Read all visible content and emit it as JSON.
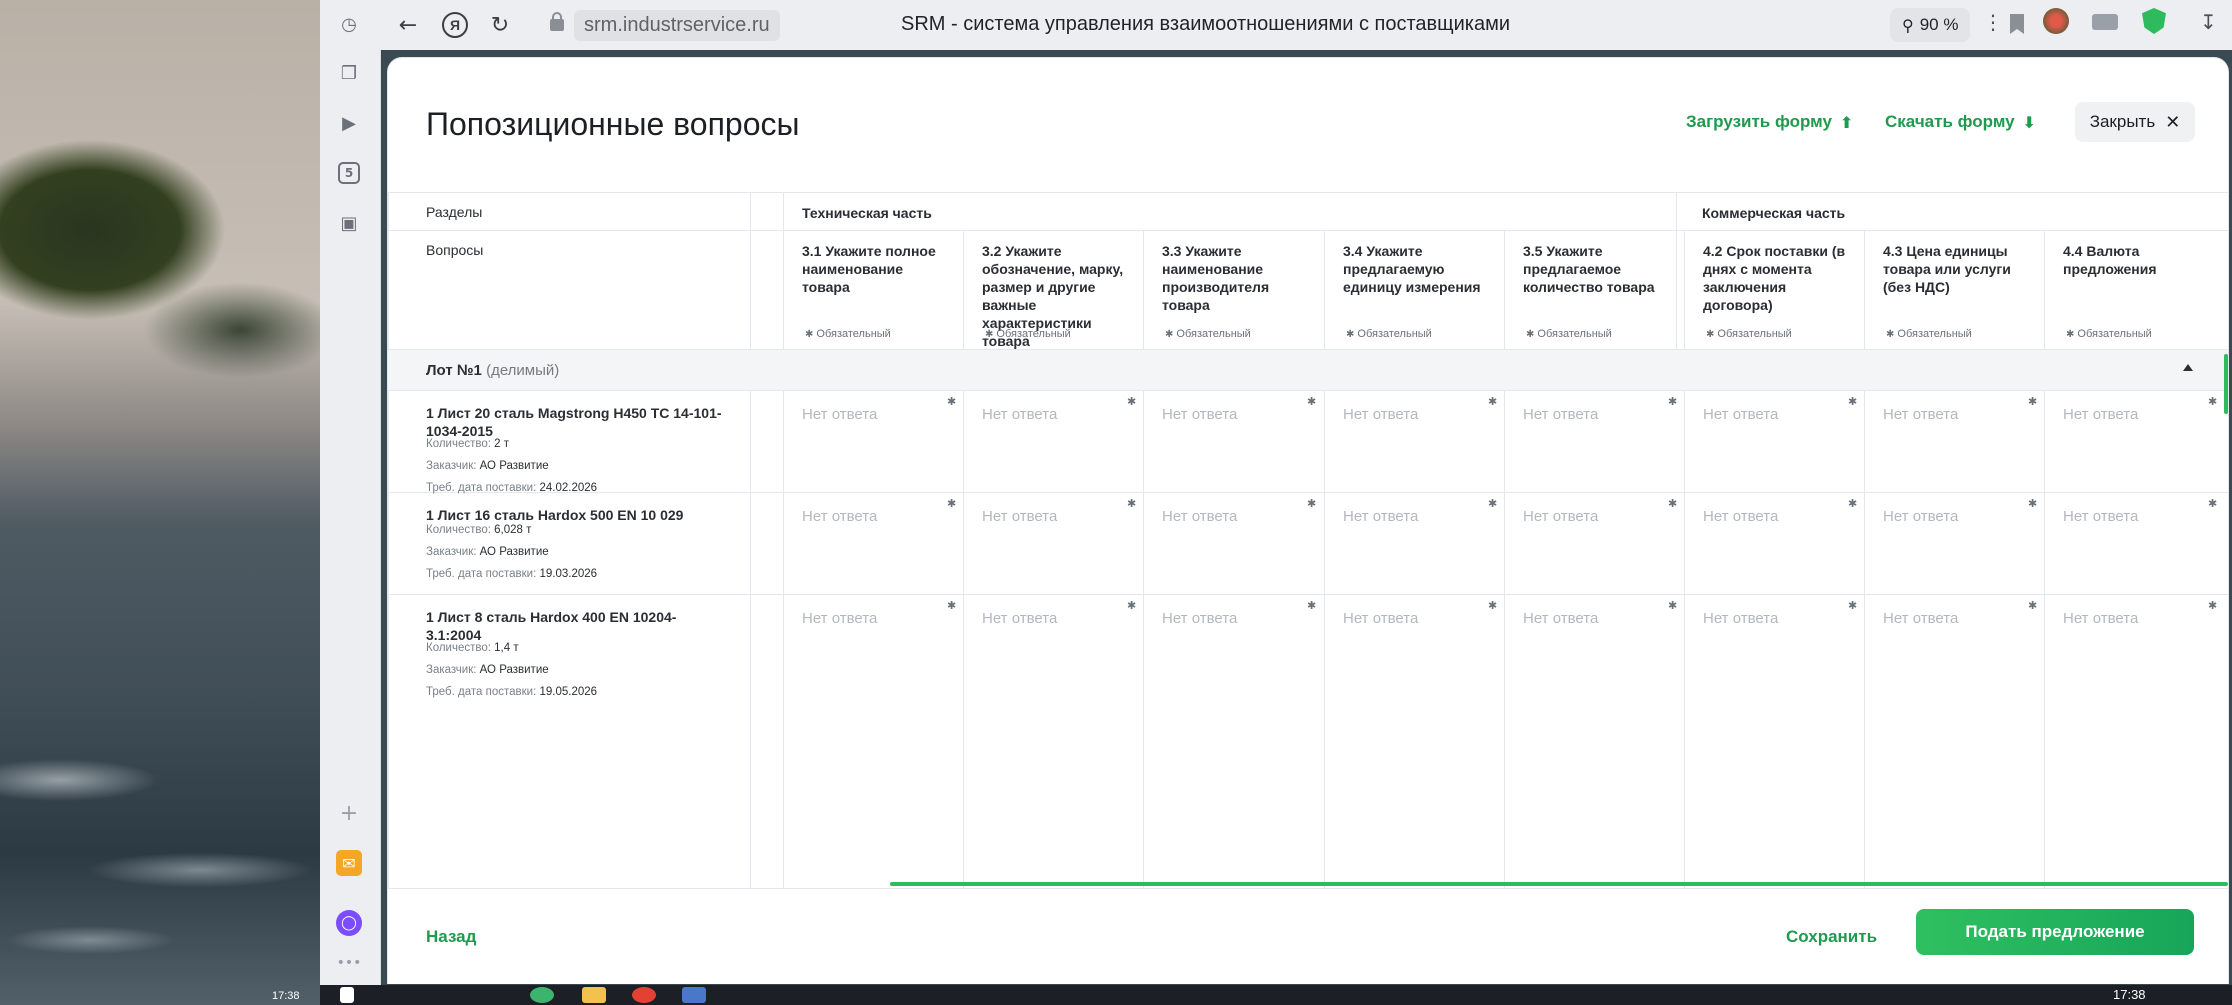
{
  "browser": {
    "url": "srm.industrservice.ru",
    "page_title": "SRM - система управления взаимоотношениями с поставщиками",
    "zoom": "90 %",
    "sidebar_badge": "5"
  },
  "page": {
    "title": "Попозиционные вопросы",
    "actions": {
      "upload_label": "Загрузить форму",
      "download_label": "Скачать форму",
      "close_label": "Закрыть"
    }
  },
  "table": {
    "sections_label": "Разделы",
    "questions_label": "Вопросы",
    "sections": [
      {
        "name": "Техническая часть"
      },
      {
        "name": "Коммерческая часть"
      }
    ],
    "required_label": "Обязательный",
    "questions": [
      {
        "label": "3.1 Укажите полное наименование товара"
      },
      {
        "label": "3.2 Укажите обозначение, марку, размер и другие важные характеристики товара"
      },
      {
        "label": "3.3 Укажите наименование производителя товара"
      },
      {
        "label": "3.4 Укажите предлагаемую единицу измерения"
      },
      {
        "label": "3.5 Укажите предлагаемое количество товара"
      },
      {
        "label": "4.2 Срок поставки (в днях с момента заключения договора)"
      },
      {
        "label": "4.3 Цена единицы товара или услуги (без НДС)"
      },
      {
        "label": "4.4 Валюта предложения"
      }
    ],
    "lot": {
      "title": "Лот №1",
      "subtitle": "(делимый)"
    },
    "no_answer": "Нет ответа",
    "meta_labels": {
      "qty": "Количество:",
      "customer": "Заказчик:",
      "date": "Треб. дата поставки:"
    },
    "items": [
      {
        "title": "1 Лист 20 сталь Magstrong H450 ТС 14-101-1034-2015",
        "qty": "2 т",
        "customer": "АО Развитие",
        "date": "24.02.2026"
      },
      {
        "title": "1 Лист 16 сталь Hardox 500 EN 10 029",
        "qty": "6,028 т",
        "customer": "АО Развитие",
        "date": "19.03.2026"
      },
      {
        "title": "1 Лист 8 сталь Hardox 400 EN 10204-3.1:2004",
        "qty": "1,4 т",
        "customer": "АО Развитие",
        "date": "19.05.2026"
      }
    ]
  },
  "footer": {
    "back_label": "Назад",
    "save_label": "Сохранить",
    "submit_label": "Подать предложение"
  },
  "desktop": {
    "clock_left": "17:38",
    "clock_tray": "17:38"
  },
  "colors": {
    "accent_green": "#1f9a4e",
    "submit_green": "#2fc060"
  }
}
